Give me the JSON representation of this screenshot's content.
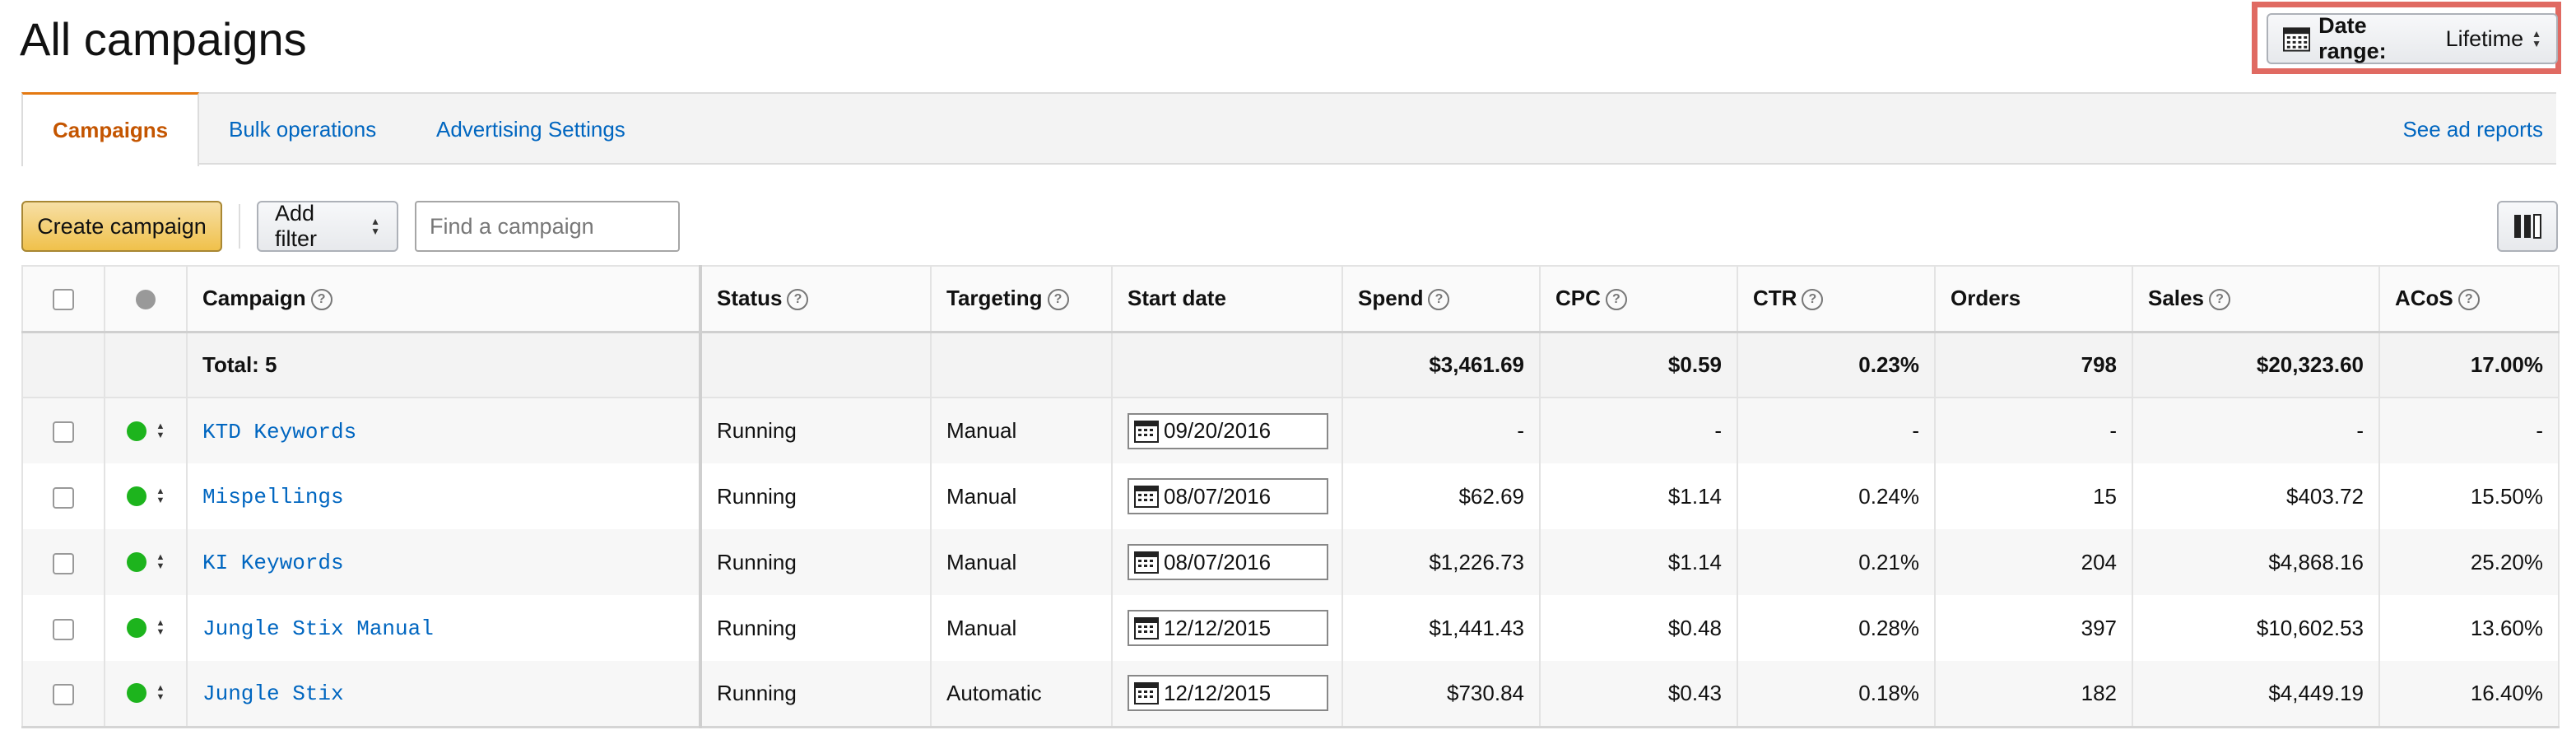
{
  "page": {
    "title": "All campaigns"
  },
  "date_range": {
    "label": "Date range:",
    "value": "Lifetime"
  },
  "tabs": [
    {
      "label": "Campaigns",
      "active": true
    },
    {
      "label": "Bulk operations",
      "active": false
    },
    {
      "label": "Advertising Settings",
      "active": false
    }
  ],
  "see_reports_label": "See ad reports",
  "toolbar": {
    "create_label": "Create campaign",
    "filter_label": "Add filter",
    "search_placeholder": "Find a campaign"
  },
  "table": {
    "headers": {
      "campaign": "Campaign",
      "status": "Status",
      "targeting": "Targeting",
      "start_date": "Start date",
      "spend": "Spend",
      "cpc": "CPC",
      "ctr": "CTR",
      "orders": "Orders",
      "sales": "Sales",
      "acos": "ACoS"
    },
    "total": {
      "label": "Total: 5",
      "spend": "$3,461.69",
      "cpc": "$0.59",
      "ctr": "0.23%",
      "orders": "798",
      "sales": "$20,323.60",
      "acos": "17.00%"
    },
    "rows": [
      {
        "name": "KTD Keywords",
        "status": "Running",
        "targeting": "Manual",
        "start_date": "09/20/2016",
        "spend": "-",
        "cpc": "-",
        "ctr": "-",
        "orders": "-",
        "sales": "-",
        "acos": "-"
      },
      {
        "name": "Mispellings",
        "status": "Running",
        "targeting": "Manual",
        "start_date": "08/07/2016",
        "spend": "$62.69",
        "cpc": "$1.14",
        "ctr": "0.24%",
        "orders": "15",
        "sales": "$403.72",
        "acos": "15.50%"
      },
      {
        "name": "KI Keywords",
        "status": "Running",
        "targeting": "Manual",
        "start_date": "08/07/2016",
        "spend": "$1,226.73",
        "cpc": "$1.14",
        "ctr": "0.21%",
        "orders": "204",
        "sales": "$4,868.16",
        "acos": "25.20%"
      },
      {
        "name": "Jungle Stix Manual",
        "status": "Running",
        "targeting": "Manual",
        "start_date": "12/12/2015",
        "spend": "$1,441.43",
        "cpc": "$0.48",
        "ctr": "0.28%",
        "orders": "397",
        "sales": "$10,602.53",
        "acos": "13.60%"
      },
      {
        "name": "Jungle Stix",
        "status": "Running",
        "targeting": "Automatic",
        "start_date": "12/12/2015",
        "spend": "$730.84",
        "cpc": "$0.43",
        "ctr": "0.18%",
        "orders": "182",
        "sales": "$4,449.19",
        "acos": "16.40%"
      }
    ]
  },
  "colors": {
    "accent_orange": "#c45500",
    "link_blue": "#0066c0",
    "running_green": "#1db41d",
    "highlight_red": "#e06a62",
    "primary_button": "#f0c14b"
  }
}
